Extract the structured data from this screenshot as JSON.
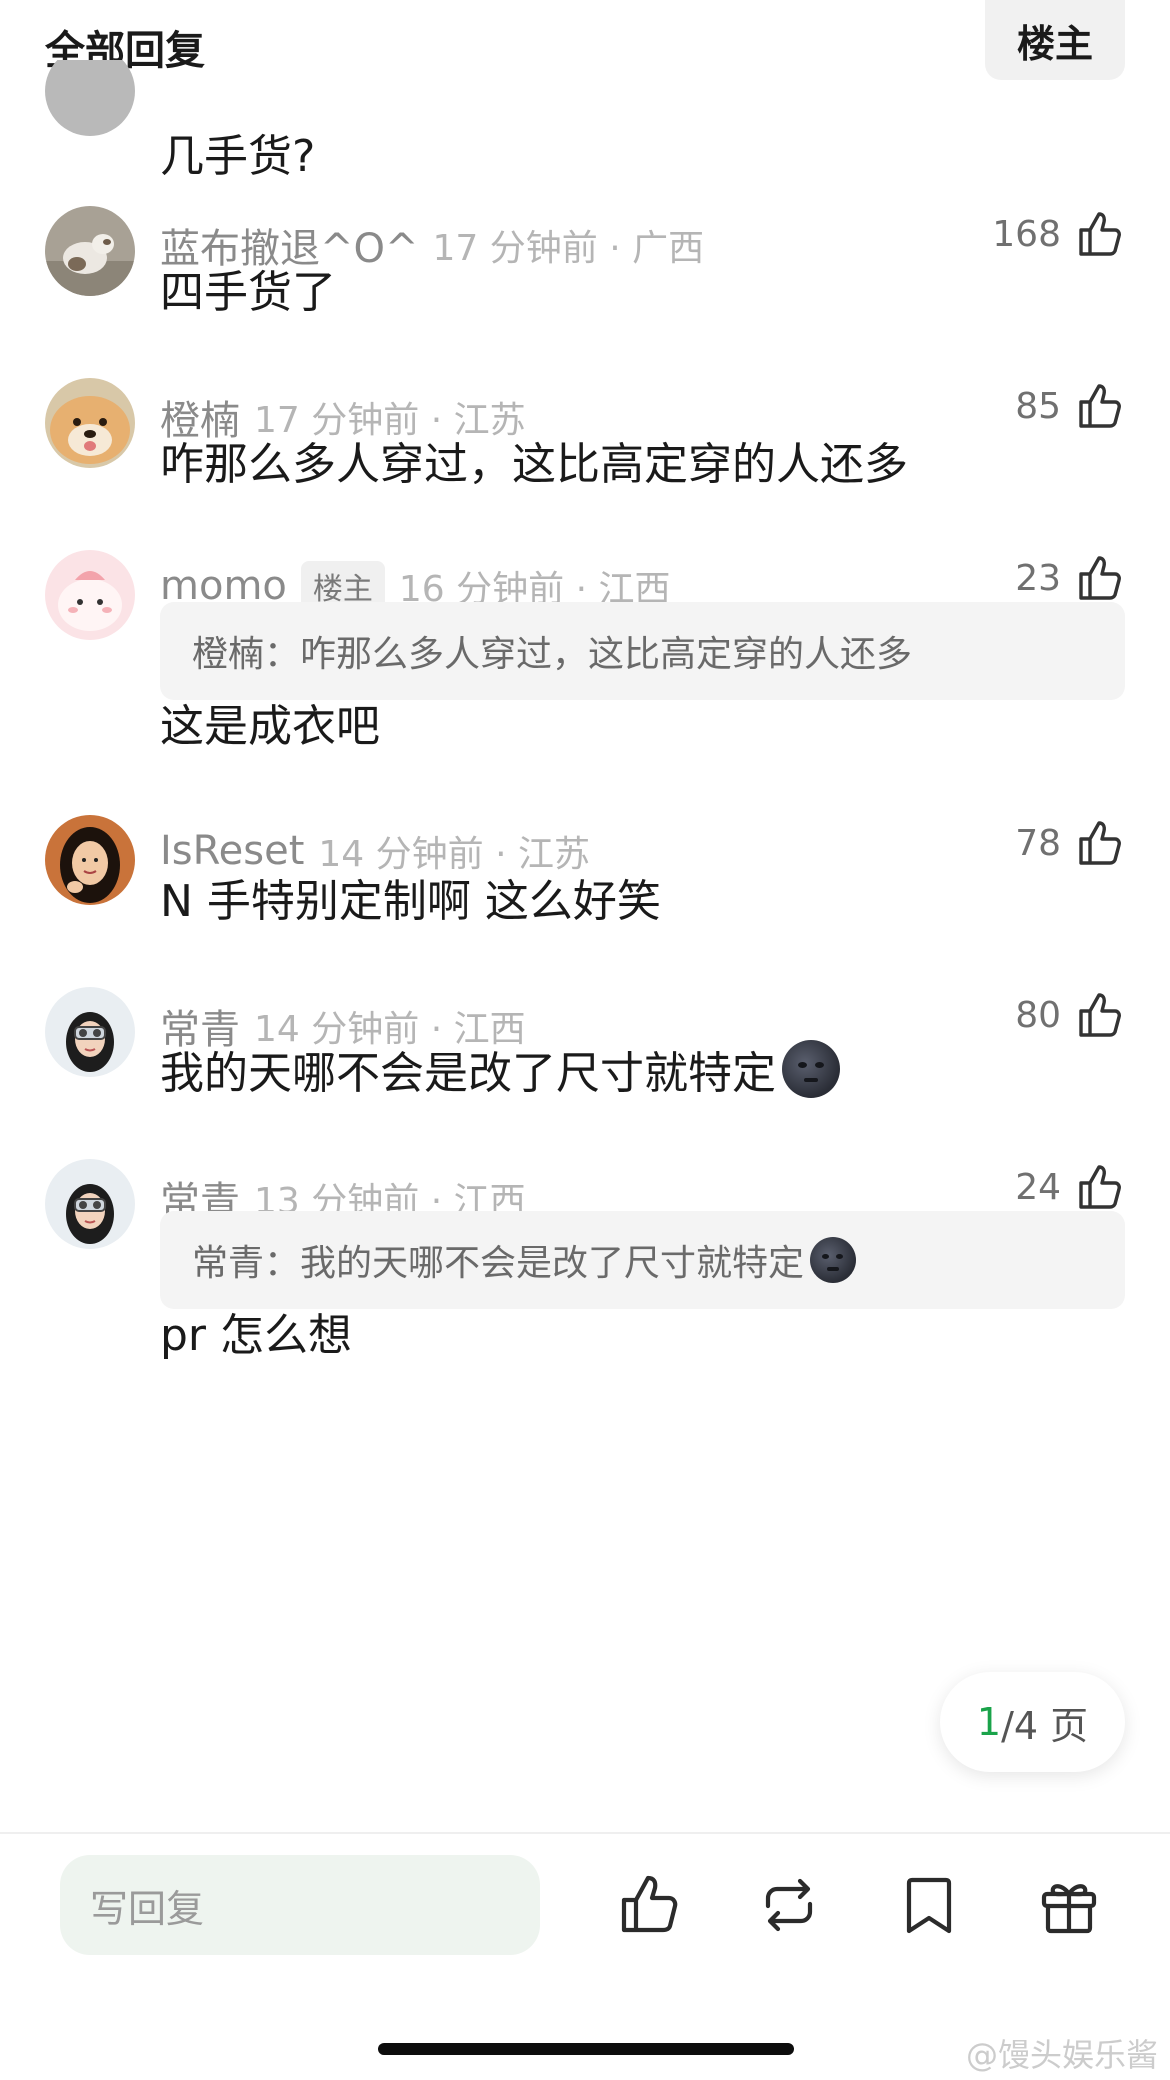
{
  "header": {
    "title": "全部回复",
    "owner_filter": "楼主"
  },
  "top_partial": {
    "text": "几手货?"
  },
  "comments": [
    {
      "name": "蓝布撤退^O^",
      "time": "17 分钟前 · 广西",
      "likes": "168",
      "text": "四手货了"
    },
    {
      "name": "橙楠",
      "time": "17 分钟前 · 江苏",
      "likes": "85",
      "text": "咋那么多人穿过，这比高定穿的人还多"
    },
    {
      "name": "momo",
      "badge": "楼主",
      "time": "16 分钟前 · 江西",
      "likes": "23",
      "quote": "橙楠：咋那么多人穿过，这比高定穿的人还多",
      "text": "这是成衣吧"
    },
    {
      "name": "IsReset",
      "time": "14 分钟前 · 江苏",
      "likes": "78",
      "text": "N 手特别定制啊 这么好笑"
    },
    {
      "name": "常青",
      "time": "14 分钟前 · 江西",
      "likes": "80",
      "text": "我的天哪不会是改了尺寸就特定"
    },
    {
      "name": "常青",
      "time": "13 分钟前 · 江西",
      "likes": "24",
      "quote": "常青：我的天哪不会是改了尺寸就特定",
      "text": "pr 怎么想"
    }
  ],
  "pagination": {
    "current": "1",
    "rest": "/4 页"
  },
  "bottom_bar": {
    "reply_placeholder": "写回复"
  },
  "watermark": "@馒头娱乐酱",
  "colors": {
    "accent_green": "#1aa34a",
    "meta_gray": "#8a8a8a",
    "time_gray": "#b5b5b5"
  },
  "icons": [
    "thumbs-up-icon",
    "repost-icon",
    "bookmark-icon",
    "gift-icon",
    "dark-moon-face-emoji"
  ]
}
